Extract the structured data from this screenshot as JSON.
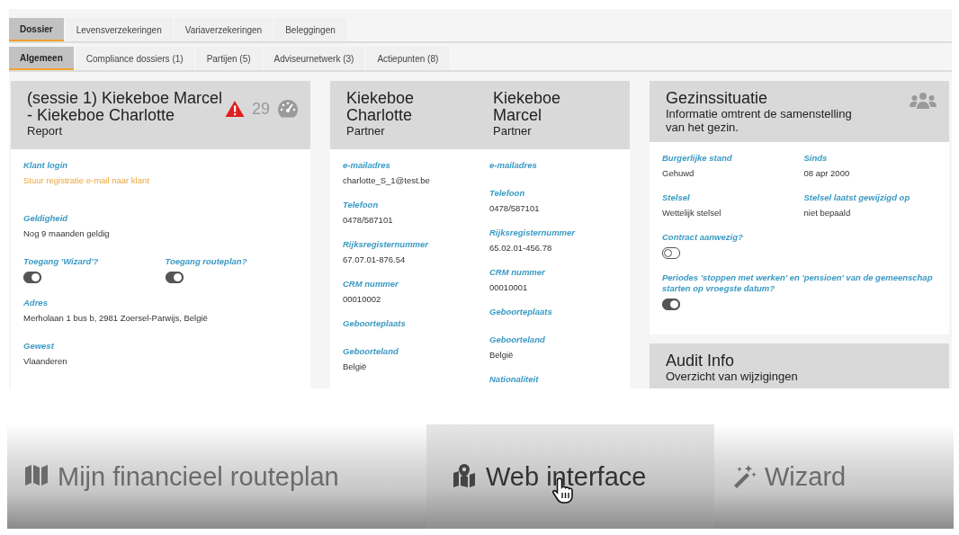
{
  "tabs": [
    {
      "label": "Dossier",
      "selected": true
    },
    {
      "label": "Levensverzekeringen",
      "selected": false
    },
    {
      "label": "Variaverzekeringen",
      "selected": false
    },
    {
      "label": "Beleggingen",
      "selected": false
    }
  ],
  "subtabs": [
    {
      "label": "Algemeen",
      "selected": true
    },
    {
      "label": "Compliance dossiers (1)",
      "selected": false
    },
    {
      "label": "Partijen (5)",
      "selected": false
    },
    {
      "label": "Adviseurnetwerk (3)",
      "selected": false
    },
    {
      "label": "Actiepunten (8)",
      "selected": false
    }
  ],
  "session_panel": {
    "title": "(sessie 1) Kiekeboe Marcel - Kiekeboe Charlotte",
    "subtitle": "Report",
    "alert": true,
    "score": "29",
    "rows": [
      [
        {
          "label": "Klant login",
          "kind": "link",
          "value": "Stuur registratie e-mail naar klant"
        }
      ],
      [
        {
          "label": "Geldigheid",
          "kind": "text",
          "value": "Nog 9 maanden geldig"
        }
      ],
      [
        {
          "label": "Toegang 'Wizard'?",
          "kind": "toggle",
          "on": true
        },
        {
          "label": "Toegang routeplan?",
          "kind": "toggle",
          "on": true
        }
      ],
      [
        {
          "label": "Adres",
          "kind": "text",
          "value": "Merholaan 1 bus b, 2981 Zoersel-Parwijs, België"
        }
      ],
      [
        {
          "label": "Gewest",
          "kind": "text",
          "value": "Vlaanderen"
        }
      ]
    ]
  },
  "partner_panel": {
    "persons": [
      {
        "name": "Kiekeboe Charlotte",
        "role": "Partner",
        "fields": [
          {
            "label": "e-mailadres",
            "kind": "text",
            "value": "charlotte_S_1@test.be"
          },
          {
            "label": "Telefoon",
            "kind": "text",
            "value": "0478/587101"
          },
          {
            "label": "Rijksregisternummer",
            "kind": "text",
            "value": "67.07.01-876.54"
          },
          {
            "label": "CRM nummer",
            "kind": "text",
            "value": "00010002"
          },
          {
            "label": "Geboorteplaats",
            "kind": "empty"
          },
          {
            "label": "Geboorteland",
            "kind": "text",
            "value": "België"
          }
        ]
      },
      {
        "name": "Kiekeboe Marcel",
        "role": "Partner",
        "fields": [
          {
            "label": "e-mailadres",
            "kind": "empty"
          },
          {
            "label": "Telefoon",
            "kind": "text",
            "value": "0478/587101"
          },
          {
            "label": "Rijksregisternummer",
            "kind": "text",
            "value": "65.02.01-456.78"
          },
          {
            "label": "CRM nummer",
            "kind": "text",
            "value": "00010001"
          },
          {
            "label": "Geboorteplaats",
            "kind": "empty"
          },
          {
            "label": "Geboorteland",
            "kind": "text",
            "value": "België"
          },
          {
            "label": "Nationaliteit",
            "kind": "empty"
          }
        ]
      }
    ]
  },
  "family_panel": {
    "title": "Gezinssituatie",
    "subtitle": "Informatie omtrent de samenstelling van het gezin.",
    "rows": [
      [
        {
          "label": "Burgerlijke stand",
          "kind": "text",
          "value": "Gehuwd"
        },
        {
          "label": "Sinds",
          "kind": "text",
          "value": "08 apr 2000"
        }
      ],
      [
        {
          "label": "Stelsel",
          "kind": "text",
          "value": "Wettelijk stelsel"
        },
        {
          "label": "Stelsel laatst gewijzigd op",
          "kind": "text",
          "value": "niet bepaald"
        }
      ],
      [
        {
          "label": "Contract aanwezig?",
          "kind": "toggle",
          "on": false
        }
      ],
      [
        {
          "label": "Periodes 'stoppen met werken' en 'pensioen' van de gemeenschap starten op vroegste datum?",
          "kind": "toggle",
          "on": true
        }
      ]
    ]
  },
  "audit_panel": {
    "title": "Audit Info",
    "subtitle": "Overzicht van wijzigingen"
  },
  "bottom_bar": [
    {
      "label": "Mijn financieel routeplan",
      "kind": "map",
      "selected": false
    },
    {
      "label": "Web interface",
      "kind": "map-pin",
      "selected": true
    },
    {
      "label": "Wizard",
      "kind": "wand",
      "selected": false
    }
  ]
}
